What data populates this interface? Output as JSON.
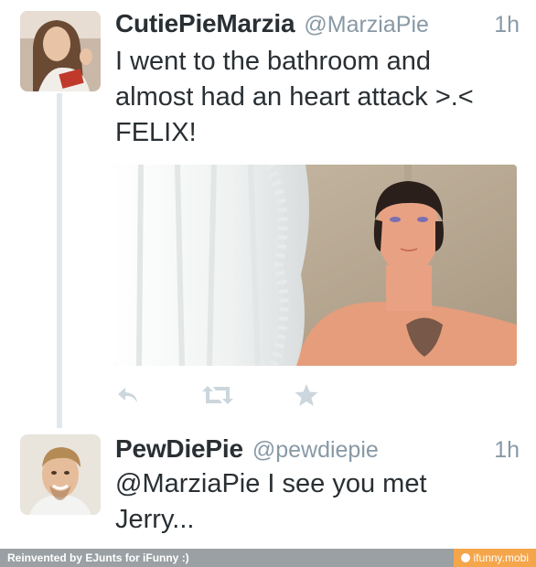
{
  "tweets": [
    {
      "name": "CutiePieMarzia",
      "handle": "@MarziaPie",
      "time": "1h",
      "text": "I went to the bathroom and\nalmost had an heart attack >.<\nFELIX!",
      "has_photo": true
    },
    {
      "name": "PewDiePie",
      "handle": "@pewdiepie",
      "time": "1h",
      "text": "@MarziaPie I see you met\nJerry..."
    }
  ],
  "actions": {
    "reply_icon": "reply-icon",
    "retweet_icon": "retweet-icon",
    "favorite_icon": "star-icon"
  },
  "footer": {
    "left": "Reinvented by EJunts for iFunny :)",
    "right": "ifunny.mobi"
  },
  "colors": {
    "text": "#292f33",
    "muted": "#8899a6",
    "icon": "#ccd6dd",
    "thread_line": "#e1e8ed",
    "footer_bg": "#9aa0a4",
    "footer_badge": "#f5a54a"
  }
}
